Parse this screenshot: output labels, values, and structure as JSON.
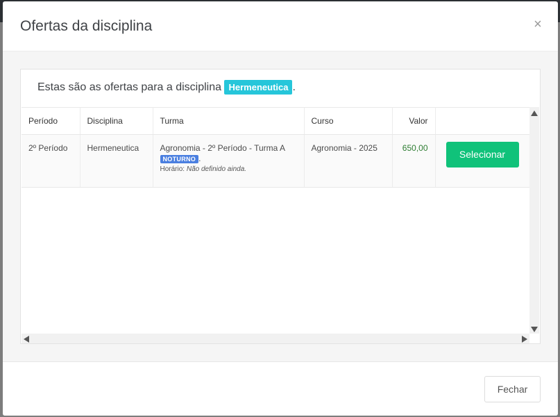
{
  "modal": {
    "title": "Ofertas da disciplina",
    "close_symbol": "×",
    "intro_text": "Estas são as ofertas para a disciplina ",
    "intro_subject": "Hermeneutica",
    "intro_end": "."
  },
  "table": {
    "headers": [
      "Período",
      "Disciplina",
      "Turma",
      "Curso",
      "Valor",
      ""
    ],
    "rows": [
      {
        "periodo": "2º Período",
        "disciplina": "Hermeneutica",
        "turma": "Agronomia - 2º Período - Turma A",
        "turno": "NOTURNO",
        "turno_end": ".",
        "horario_label": "Horário: ",
        "horario_value": "Não definido ainda.",
        "curso": "Agronomia - 2025",
        "valor": "650,00",
        "action_label": "Selecionar"
      }
    ]
  },
  "footer": {
    "close_label": "Fechar"
  },
  "colors": {
    "accent_tag": "#26c6da",
    "select_button": "#10c27a",
    "turno_badge": "#4a7fe0",
    "valor_text": "#2e7d32"
  },
  "icons": {
    "close": "close-icon",
    "scroll_up": "arrow-up-icon",
    "scroll_down": "arrow-down-icon",
    "scroll_left": "arrow-left-icon",
    "scroll_right": "arrow-right-icon"
  }
}
